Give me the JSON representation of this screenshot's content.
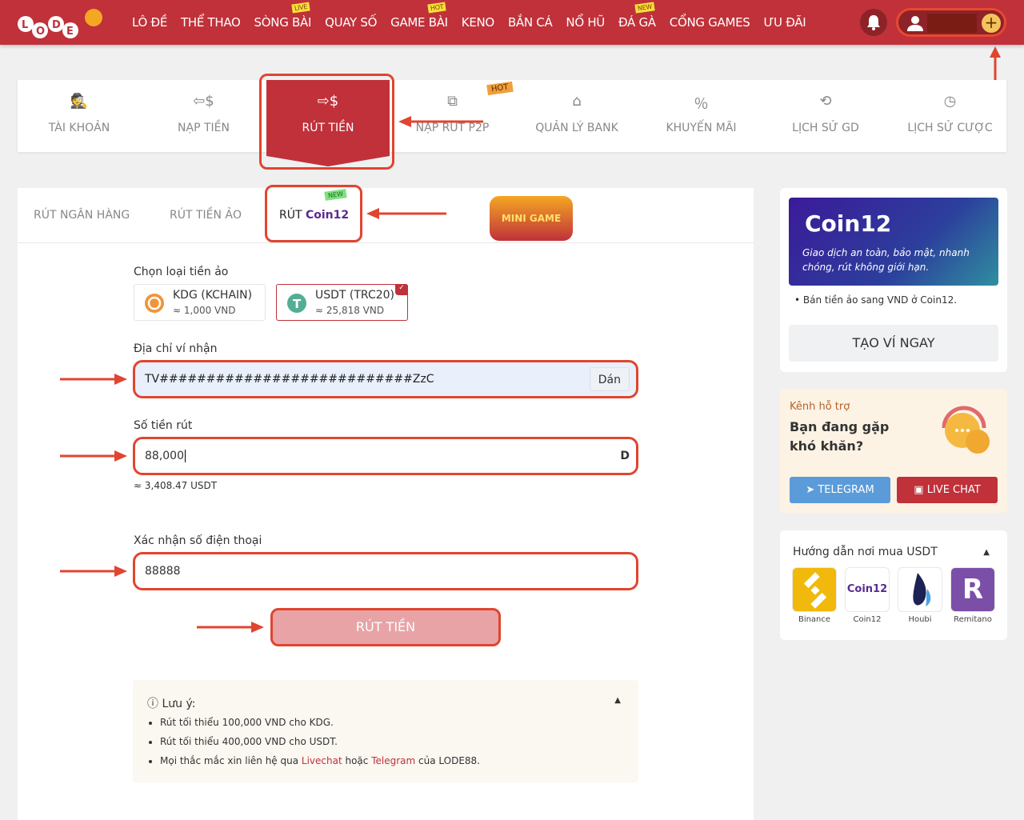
{
  "header": {
    "brand": "LODE88",
    "nav": [
      {
        "label": "LÔ ĐỀ"
      },
      {
        "label": "THỂ THAO"
      },
      {
        "label": "SÒNG BÀI",
        "badge": "LIVE"
      },
      {
        "label": "QUAY SỐ"
      },
      {
        "label": "GAME BÀI",
        "badge": "HOT"
      },
      {
        "label": "KENO"
      },
      {
        "label": "BẮN CÁ"
      },
      {
        "label": "NỔ HŨ"
      },
      {
        "label": "ĐÁ GÀ",
        "badge": "NEW"
      },
      {
        "label": "CỔNG GAMES"
      },
      {
        "label": "ƯU ĐÃI"
      }
    ],
    "plus": "+"
  },
  "tabs": [
    {
      "label": "TÀI KHOẢN",
      "icon": "spy-icon"
    },
    {
      "label": "NẠP TIỀN",
      "icon": "deposit-icon"
    },
    {
      "label": "RÚT TIỀN",
      "icon": "withdraw-icon",
      "active": true
    },
    {
      "label": "NẠP RÚT P2P",
      "icon": "p2p-icon",
      "badge": "HOT"
    },
    {
      "label": "QUẢN LÝ BANK",
      "icon": "bank-icon"
    },
    {
      "label": "KHUYẾN MÃI",
      "icon": "ticket-icon"
    },
    {
      "label": "LỊCH SỬ GD",
      "icon": "history-icon"
    },
    {
      "label": "LỊCH SỬ CƯỢC",
      "icon": "clock-icon"
    }
  ],
  "subtabs": {
    "bank": "RÚT NGÂN HÀNG",
    "virtual": "RÚT TIỀN ẢO",
    "coin12_prefix": "RÚT",
    "coin12_logo": "Coin12",
    "coin12_badge": "NEW",
    "minigame": "MINI GAME"
  },
  "form": {
    "coin_label": "Chọn loại tiền ảo",
    "coins": [
      {
        "name": "KDG (KCHAIN)",
        "rate": "≈ 1,000 VND"
      },
      {
        "name": "USDT (TRC20)",
        "rate": "≈ 25,818 VND",
        "selected": true
      }
    ],
    "address_label": "Địa chỉ ví nhận",
    "address_value": "TV###########################ZzC",
    "paste": "Dán",
    "amount_label": "Số tiền rút",
    "amount_value": "88,000",
    "amount_unit": "D",
    "amount_conv": "≈ 3,408.47 USDT",
    "phone_label": "Xác nhận số điện thoại",
    "phone_value": "88888",
    "submit": "RÚT TIỀN"
  },
  "note": {
    "title": "Lưu ý:",
    "items": [
      "Rút tối thiểu 100,000 VND cho KDG.",
      "Rút tối thiểu 400,000 VND cho USDT."
    ],
    "last_prefix": "Mọi thắc mắc xin liên hệ qua ",
    "livechat": "Livechat",
    "mid": " hoặc ",
    "telegram": "Telegram",
    "suffix": " của LODE88."
  },
  "promo": {
    "logo": "Coin12",
    "tagline": "Giao dịch an toàn, bảo mật, nhanh chóng, rút không giới hạn.",
    "bullet": "Bán tiền ảo sang VND ở Coin12.",
    "cta": "TẠO VÍ NGAY"
  },
  "support": {
    "kicker": "Kênh hỗ trợ",
    "title": "Bạn đang gặp khó khăn?",
    "telegram": "TELEGRAM",
    "livechat": "LIVE CHAT"
  },
  "guide": {
    "title": "Hướng dẫn nơi mua USDT",
    "exchanges": [
      {
        "name": "Binance",
        "color": "#f0b90b"
      },
      {
        "name": "Coin12",
        "color": "#ffffff"
      },
      {
        "name": "Houbi",
        "color": "#ffffff"
      },
      {
        "name": "Remitano",
        "color": "#7b4fa8"
      }
    ]
  },
  "colors": {
    "brand": "#c0313a",
    "annotation": "#e0452f",
    "telegram": "#5b9bd9"
  }
}
